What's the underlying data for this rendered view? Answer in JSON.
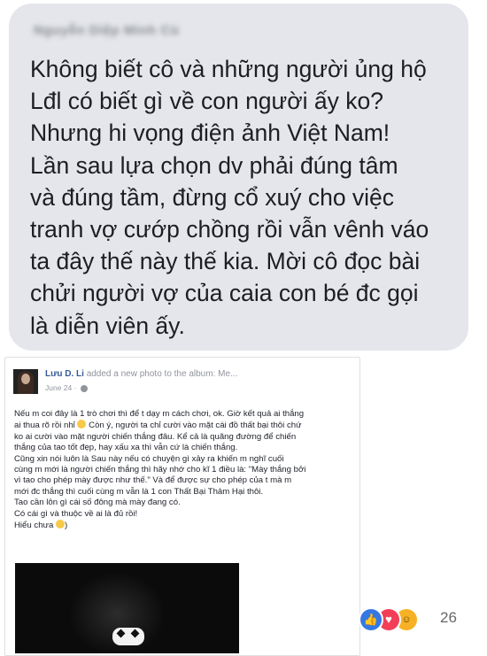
{
  "comment": {
    "author_name": "Nguyễn Diệp Minh Cù",
    "lines": [
      "Không biết cô và những người ủng hộ",
      "Lđl có biết gì về con người ấy ko?",
      "Nhưng hi vọng điện ảnh Việt Nam!",
      "Lần sau lựa chọn dv phải đúng tâm",
      "và đúng tầm, đừng cổ xuý cho việc",
      "tranh vợ cướp chồng rồi vẫn vênh váo",
      "ta đây thế này thế kia. Mời cô đọc bài",
      "chửi người vợ của caia con bé đc gọi",
      "là diễn viên ấy."
    ]
  },
  "shared_post": {
    "author": "Lưu D. Li",
    "action_text": "added a new photo to the album: Me...",
    "date": "June 24 ·",
    "lines": [
      "Nếu m coi đây là 1 trò chơi thì để t dạy m cách chơi, ok. Giờ kết quả ai thắng",
      "ai thua rõ rồi nhỉ",
      "Còn ý, người ta chỉ cười vào mặt cái đồ thất bại thôi chứ",
      "ko ai cười vào mặt người chiến thắng đâu. Kể cả là quãng đường để chiến",
      "thắng của tao tốt đẹp, hay xấu xa thì vẫn cứ là chiến thắng.",
      "Cũng xin nói luôn là Sau này nếu có chuyện gì xảy ra khiến m nghĩ cuối",
      "cùng m mới là người chiến thắng thì hãy nhớ cho kĩ 1 điều là: \"Mày thắng bởi",
      "vì tao cho phép mày được như thế.\" Và để được sự cho phép của t mà m",
      "mới đc thắng thì cuối cùng m vẫn là 1 con Thất Bại Thảm Hại thôi.",
      "Tao cần lôn gì cái số đông mà mày đang có.",
      "Có cái gì và thuộc về ai là đủ rồi!",
      "Hiểu chưa"
    ]
  },
  "reactions": {
    "count": "26",
    "icons": [
      "like-icon",
      "love-icon",
      "haha-icon"
    ],
    "colors": {
      "like": "#3578e5",
      "love": "#f33e58",
      "haha": "#f7b125"
    }
  }
}
